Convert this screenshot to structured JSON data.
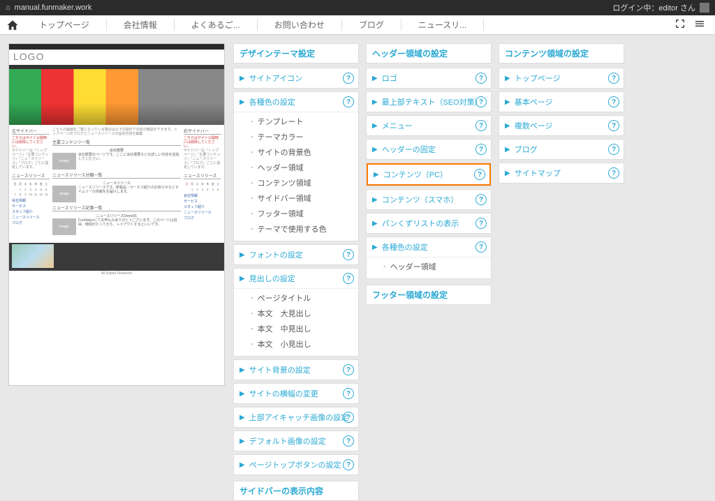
{
  "topbar": {
    "url": "manual.funmaker.work",
    "login": "ログイン中：editor さん"
  },
  "nav": {
    "items": [
      "トップページ",
      "会社情報",
      "よくあるご...",
      "お問い合わせ",
      "ブログ",
      "ニュースリ..."
    ]
  },
  "preview": {
    "logo": "LOGO",
    "leftSideTitle": "左サイドバー",
    "rightSideTitle": "右サイドバー",
    "red1": "こちらはサイト公開時には削除してください。",
    "newsTitle": "ニュースリリース",
    "sec1": "主要コンテンツ一覧",
    "sec1a": "会社概要",
    "sec2": "ニュースリリース分類一覧",
    "sec2a": "ニュースリリース",
    "sec3": "ニュースリリース記事一覧",
    "sec3a": "ニュースリリースDemo01",
    "links": [
      "会社情報",
      "サービス",
      "スタッフ紹介",
      "ニュースリリース",
      "ブログ"
    ],
    "copy": "All Rights Reserved"
  },
  "panels": [
    {
      "title": "デザインテーマ設定",
      "boxes": [
        {
          "rows": [
            {
              "label": "サイトアイコン",
              "help": true
            }
          ]
        },
        {
          "rows": [
            {
              "label": "各種色の設定",
              "help": true
            }
          ],
          "subs": [
            "テンプレート",
            "テーマカラー",
            "サイトの背景色",
            "ヘッダー領域",
            "コンテンツ領域",
            "サイドバー領域",
            "フッター領域",
            "テーマで使用する色"
          ]
        },
        {
          "rows": [
            {
              "label": "フォントの設定",
              "help": true
            }
          ]
        },
        {
          "rows": [
            {
              "label": "見出しの設定",
              "help": true
            }
          ],
          "subs": [
            "ページタイトル",
            "本文　大見出し",
            "本文　中見出し",
            "本文　小見出し"
          ]
        },
        {
          "rows": [
            {
              "label": "サイト背景の設定",
              "help": true
            }
          ]
        },
        {
          "rows": [
            {
              "label": "サイトの横幅の変更",
              "help": true
            }
          ]
        },
        {
          "rows": [
            {
              "label": "上部アイキャッチ画像の設定",
              "help": true
            }
          ]
        },
        {
          "rows": [
            {
              "label": "デフォルト画像の設定",
              "help": true
            }
          ]
        },
        {
          "rows": [
            {
              "label": "ページトップボタンの設定",
              "help": true
            }
          ]
        }
      ],
      "footer": "サイドバーの表示内容"
    },
    {
      "title": "ヘッダー領域の設定",
      "boxes": [
        {
          "rows": [
            {
              "label": "ロゴ",
              "help": true
            }
          ]
        },
        {
          "rows": [
            {
              "label": "最上部テキスト（SEO対策）",
              "help": true
            }
          ]
        },
        {
          "rows": [
            {
              "label": "メニュー",
              "help": true
            }
          ]
        },
        {
          "rows": [
            {
              "label": "ヘッダーの固定",
              "help": true
            }
          ]
        },
        {
          "rows": [
            {
              "label": "コンテンツ（PC）",
              "help": true,
              "highlight": true
            }
          ]
        },
        {
          "rows": [
            {
              "label": "コンテンツ（スマホ）",
              "help": true
            }
          ]
        },
        {
          "rows": [
            {
              "label": "パンくずリストの表示",
              "help": true
            }
          ]
        },
        {
          "rows": [
            {
              "label": "各種色の設定",
              "help": true
            }
          ],
          "subs": [
            "ヘッダー領域"
          ]
        }
      ],
      "footer": "フッター領域の設定"
    },
    {
      "title": "コンテンツ領域の設定",
      "boxes": [
        {
          "rows": [
            {
              "label": "トップページ",
              "help": true
            }
          ]
        },
        {
          "rows": [
            {
              "label": "基本ページ",
              "help": true
            }
          ]
        },
        {
          "rows": [
            {
              "label": "複数ページ",
              "help": true
            }
          ]
        },
        {
          "rows": [
            {
              "label": "ブログ",
              "help": true
            }
          ]
        },
        {
          "rows": [
            {
              "label": "サイトマップ",
              "help": true
            }
          ]
        }
      ]
    }
  ]
}
